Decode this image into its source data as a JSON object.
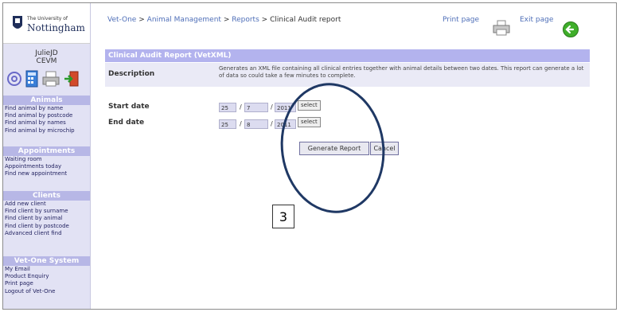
{
  "university": {
    "small": "The University of",
    "big": "Nottingham"
  },
  "user": {
    "name": "JulieJD",
    "role": "CEVM"
  },
  "toolbar_icons": [
    "email-icon",
    "calculator-icon",
    "printer-icon",
    "exit-icon"
  ],
  "sidebar": {
    "sections": [
      {
        "heading": "Animals",
        "items": [
          "Find animal by name",
          "Find animal by postcode",
          "Find animal by names",
          "Find animal by microchip"
        ]
      },
      {
        "heading": "Appointments",
        "items": [
          "Waiting room",
          "Appointments today",
          "Find new appointment"
        ]
      },
      {
        "heading": "Clients",
        "items": [
          "Add new client",
          "Find client by surname",
          "Find client by animal",
          "Find client by postcode",
          "Advanced client find"
        ]
      },
      {
        "heading": "Vet-One System",
        "items": [
          "My Email",
          "Product Enquiry",
          "Print page",
          "Logout of Vet-One"
        ]
      }
    ]
  },
  "breadcrumb": {
    "item1": "Vet-One",
    "item2": "Animal Management",
    "item3": "Reports",
    "current": "Clinical Audit report",
    "sep": ">"
  },
  "header": {
    "print_label": "Print page",
    "exit_label": "Exit page"
  },
  "report": {
    "title": "Clinical Audit Report (VetXML)",
    "description_label": "Description",
    "description_text": "Generates an XML file containing all clinical entries together with animal details between two dates. This report can generate a lot of data so could take a few minutes to complete.",
    "start_label": "Start date",
    "start": {
      "day": "25",
      "month": "7",
      "year": "2011"
    },
    "end_label": "End date",
    "end": {
      "day": "25",
      "month": "8",
      "year": "2011"
    },
    "slash": "/",
    "select_label": "select",
    "generate_label": "Generate Report",
    "cancel_label": "Cancel"
  },
  "annotation": {
    "step": "3",
    "color": "#1f3864"
  },
  "colors": {
    "sidebar_bg": "#e2e2f4",
    "section_head": "#b7b7e6",
    "panel_head": "#b3b3ee",
    "link": "#4f6fb8"
  }
}
